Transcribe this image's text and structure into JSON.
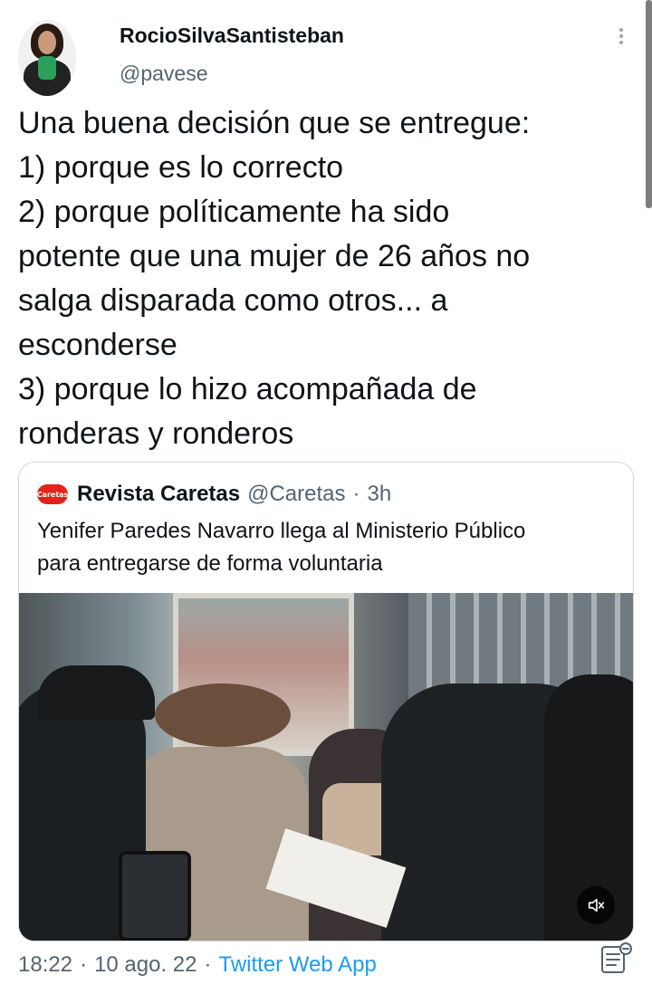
{
  "author": {
    "display_name": "RocioSilvaSantisteban",
    "handle": "@pavese"
  },
  "tweet": {
    "lines": [
      "Una buena decisión que se entregue:",
      "1) porque es lo correcto",
      "2) porque políticamente ha sido",
      "potente que una mujer de 26 años no",
      "salga disparada como otros... a",
      "esconderse",
      "3) porque lo hizo acompañada de",
      "ronderas y ronderos"
    ]
  },
  "quoted_tweet": {
    "logo_text": "Caretas",
    "display_name": "Revista Caretas",
    "handle": "@Caretas",
    "separator": "·",
    "time": "3h",
    "lines": [
      "Yenifer Paredes Navarro llega al Ministerio Público",
      "para entregarse de forma voluntaria"
    ],
    "media": {
      "type": "video",
      "muted": true
    }
  },
  "footer": {
    "time": "18:22",
    "separator": "·",
    "date": "10 ago. 22",
    "source": "Twitter Web App"
  },
  "colors": {
    "link": "#1d9bf0",
    "secondary_text": "#536471",
    "border": "#cfd9de",
    "logo": "#e0241b"
  },
  "icons": [
    "more-options-icon",
    "mute-icon",
    "analytics-icon"
  ]
}
